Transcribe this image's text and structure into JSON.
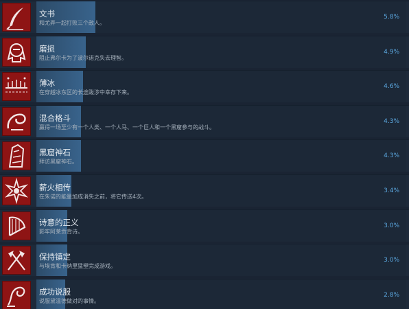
{
  "achievements": [
    {
      "title": "文书",
      "desc": "和尤弄一起打败三个敌人。",
      "pct": "5.8%",
      "progress": 0.057,
      "icon": "quill-icon"
    },
    {
      "title": "磨损",
      "desc": "阻止弗尔卡为了波尔诺克失去理智。",
      "pct": "4.9%",
      "progress": 0.048,
      "icon": "helmet-icon"
    },
    {
      "title": "薄冰",
      "desc": "在穿越冰东区的长途跋涉中幸存下来。",
      "pct": "4.6%",
      "progress": 0.045,
      "icon": "ice-crossing-icon"
    },
    {
      "title": "混合格斗",
      "desc": "赢得一场至少有一个人类、一个人马、一个巨人和一个黑窟参与的战斗。",
      "pct": "4.3%",
      "progress": 0.043,
      "icon": "swirl-hand-icon"
    },
    {
      "title": "黑窟神石",
      "desc": "拜访黑窟神石。",
      "pct": "4.3%",
      "progress": 0.043,
      "icon": "godstone-icon"
    },
    {
      "title": "薪火相传",
      "desc": "在朱诺的能量加成消失之前，将它传送4次。",
      "pct": "3.4%",
      "progress": 0.034,
      "icon": "sun-star-icon"
    },
    {
      "title": "诗意的正义",
      "desc": "影牢阿莱贡背诗。",
      "pct": "3.0%",
      "progress": 0.03,
      "icon": "harp-icon"
    },
    {
      "title": "保持镇定",
      "desc": "与埃肯和卡纳里猛塑完成游戏。",
      "pct": "3.0%",
      "progress": 0.03,
      "icon": "axes-icon"
    },
    {
      "title": "成功说服",
      "desc": "说服黛温德做对的事情。",
      "pct": "2.8%",
      "progress": 0.028,
      "icon": "persuasion-icon"
    }
  ]
}
